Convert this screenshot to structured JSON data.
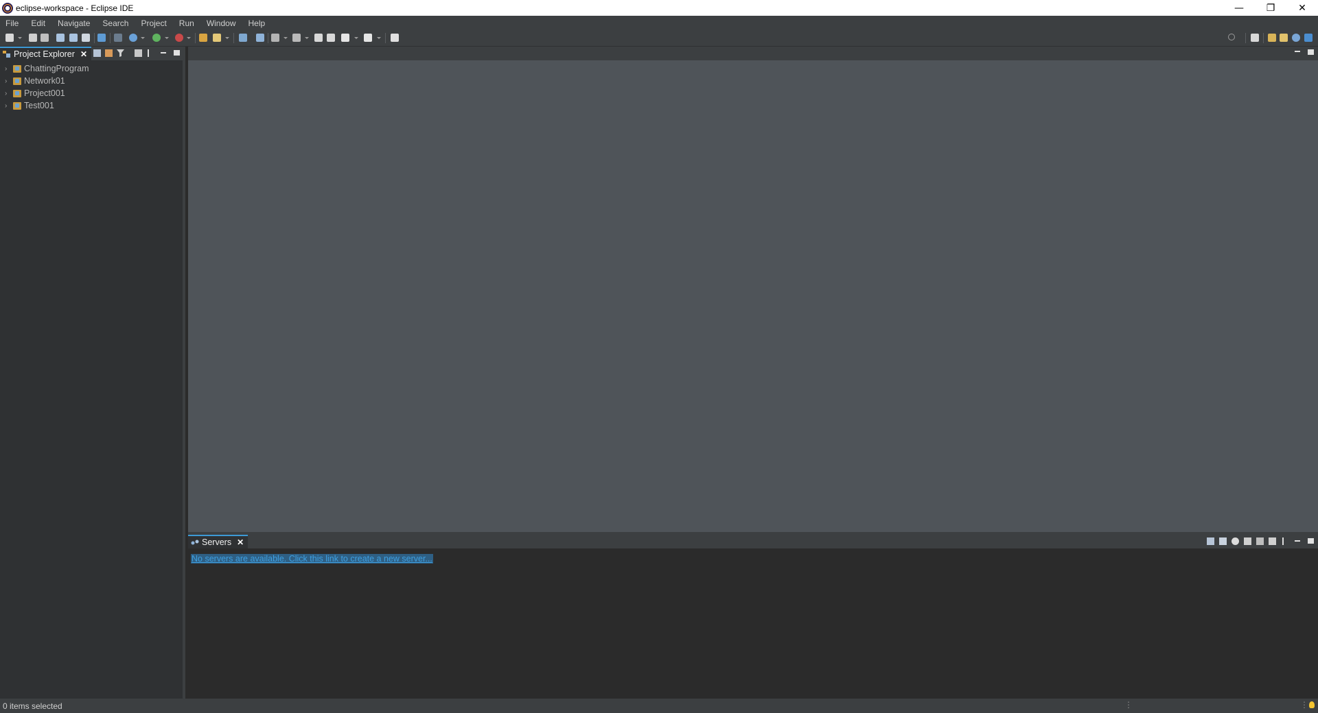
{
  "window": {
    "title": "eclipse-workspace - Eclipse IDE",
    "minimize_glyph": "—",
    "maximize_glyph": "❐",
    "close_glyph": "✕"
  },
  "menu": [
    "File",
    "Edit",
    "Navigate",
    "Search",
    "Project",
    "Run",
    "Window",
    "Help"
  ],
  "project_explorer": {
    "tab_label": "Project Explorer",
    "projects": [
      "ChattingProgram",
      "Network01",
      "Project001",
      "Test001"
    ]
  },
  "servers": {
    "tab_label": "Servers",
    "link_text": "No servers are available. Click this link to create a new server..."
  },
  "status": {
    "text": "0 items selected"
  },
  "colors": {
    "accent": "#3d9ad6",
    "link": "#3f9fe0",
    "editor_bg": "#4f5459",
    "panel_bg": "#2b2b2b"
  }
}
